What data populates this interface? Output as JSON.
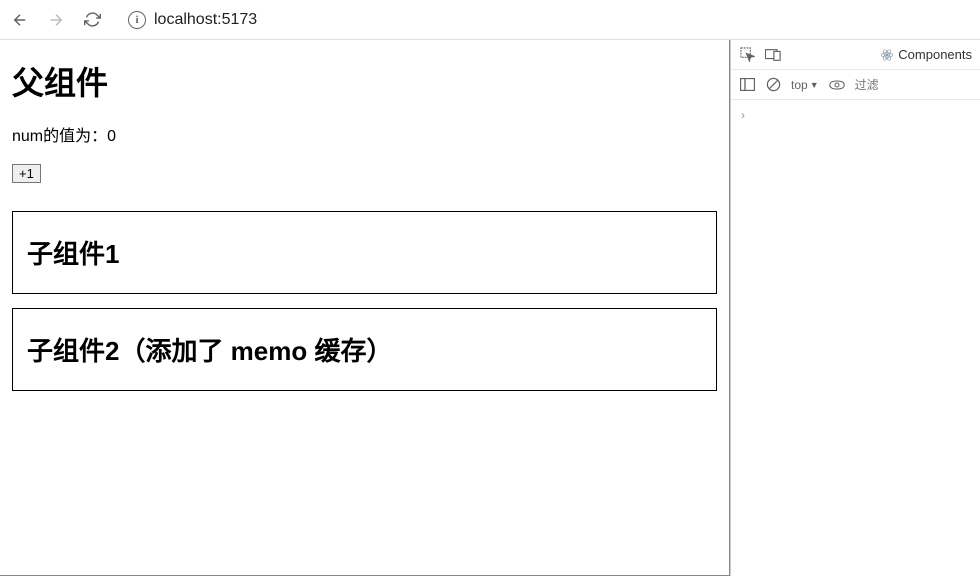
{
  "browser": {
    "url": "localhost:5173"
  },
  "page": {
    "parent_title": "父组件",
    "num_label": "num的值为：0",
    "button_label": "+1",
    "child1_title": "子组件1",
    "child2_title": "子组件2（添加了 memo 缓存）"
  },
  "devtools": {
    "components_tab": "Components",
    "context": "top",
    "filter_placeholder": "过滤",
    "tree_arrow": "›"
  }
}
